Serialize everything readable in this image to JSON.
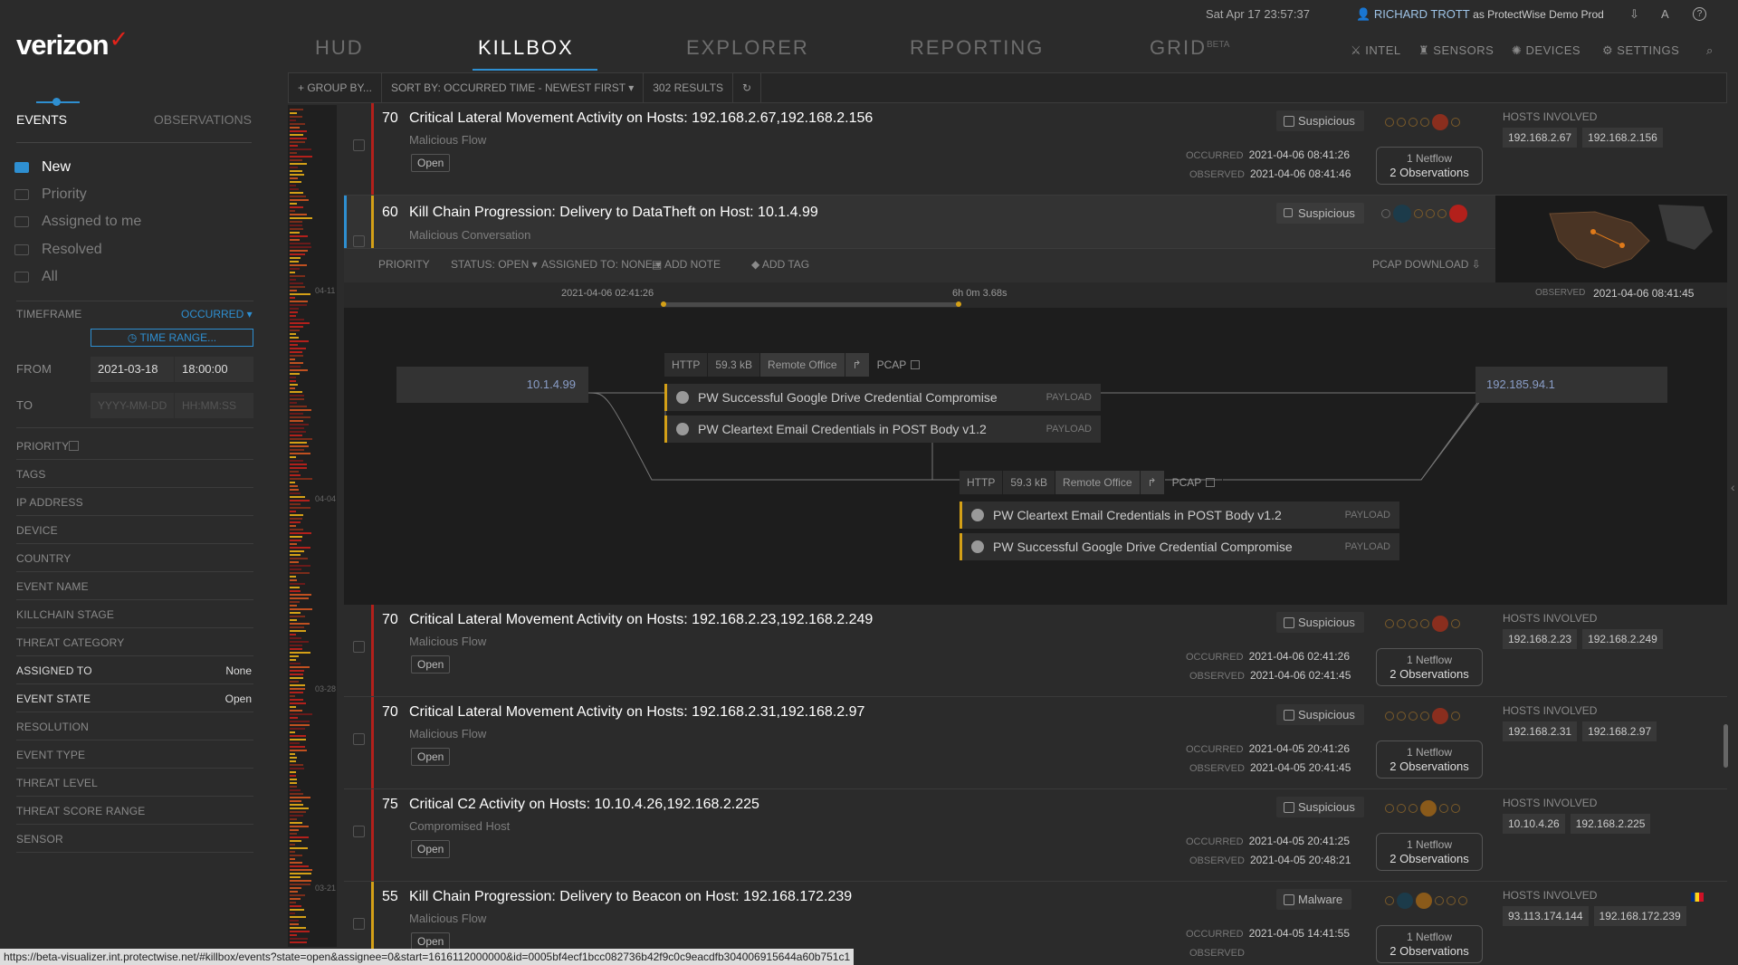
{
  "app": {
    "logo": "verizon",
    "logo_mark": "✓"
  },
  "top": {
    "datetime": "Sat Apr 17 23:57:37",
    "user": "RICHARD TROTT",
    "org": "as ProtectWise Demo Prod",
    "font_size_label": "A"
  },
  "main_tabs": [
    {
      "label": "HUD"
    },
    {
      "label": "KILLBOX"
    },
    {
      "label": "EXPLORER"
    },
    {
      "label": "REPORTING"
    },
    {
      "label": "GRID"
    }
  ],
  "grid_beta": "BETA",
  "right_nav": [
    {
      "label": "INTEL"
    },
    {
      "label": "SENSORS"
    },
    {
      "label": "DEVICES"
    },
    {
      "label": "SETTINGS"
    }
  ],
  "sidebar": {
    "tabs": [
      {
        "label": "EVENTS"
      },
      {
        "label": "OBSERVATIONS"
      }
    ],
    "folders": [
      {
        "label": "New"
      },
      {
        "label": "Priority"
      },
      {
        "label": "Assigned to me"
      },
      {
        "label": "Resolved"
      },
      {
        "label": "All"
      }
    ],
    "timeframe_label": "TIMEFRAME",
    "timeframe_value": "OCCURRED ▾",
    "time_range_button": "TIME RANGE...",
    "from_label": "FROM",
    "from_date": "2021-03-18",
    "from_time": "18:00:00",
    "to_label": "TO",
    "to_date_placeholder": "YYYY-MM-DD",
    "to_time_placeholder": "HH:MM:SS",
    "filters": [
      {
        "label": "PRIORITY",
        "value": ""
      },
      {
        "label": "TAGS",
        "value": ""
      },
      {
        "label": "IP ADDRESS",
        "value": ""
      },
      {
        "label": "DEVICE",
        "value": ""
      },
      {
        "label": "COUNTRY",
        "value": ""
      },
      {
        "label": "EVENT NAME",
        "value": ""
      },
      {
        "label": "KILLCHAIN STAGE",
        "value": ""
      },
      {
        "label": "THREAT CATEGORY",
        "value": ""
      },
      {
        "label": "ASSIGNED TO",
        "value": "None"
      },
      {
        "label": "EVENT STATE",
        "value": "Open"
      },
      {
        "label": "RESOLUTION",
        "value": ""
      },
      {
        "label": "EVENT TYPE",
        "value": ""
      },
      {
        "label": "THREAT LEVEL",
        "value": ""
      },
      {
        "label": "THREAT SCORE RANGE",
        "value": ""
      },
      {
        "label": "SENSOR",
        "value": ""
      }
    ]
  },
  "strip_dates": [
    "04-11",
    "04-04",
    "03-28",
    "03-21"
  ],
  "toolbar": {
    "group_by": "+ GROUP BY...",
    "sort_by": "SORT BY: OCCURRED TIME - NEWEST FIRST ▾",
    "results": "302 RESULTS",
    "refresh": "↻"
  },
  "events": [
    {
      "score": "70",
      "title": "Critical Lateral Movement Activity on Hosts: 192.168.2.67,192.168.2.156",
      "sub": "Malicious Flow",
      "status": "Open",
      "classification": "Suspicious",
      "occurred_label": "OCCURRED",
      "occurred": "2021-04-06 08:41:26",
      "observed_label": "OBSERVED",
      "observed": "2021-04-06 08:41:46",
      "netflow": "1 Netflow",
      "observations": "2 Observations",
      "hosts_label": "HOSTS INVOLVED",
      "hosts": [
        "192.168.2.67",
        "192.168.2.156"
      ]
    },
    {
      "score": "70",
      "title": "Critical Lateral Movement Activity on Hosts: 192.168.2.23,192.168.2.249",
      "sub": "Malicious Flow",
      "status": "Open",
      "classification": "Suspicious",
      "occurred_label": "OCCURRED",
      "occurred": "2021-04-06 02:41:26",
      "observed_label": "OBSERVED",
      "observed": "2021-04-06 02:41:45",
      "netflow": "1 Netflow",
      "observations": "2 Observations",
      "hosts_label": "HOSTS INVOLVED",
      "hosts": [
        "192.168.2.23",
        "192.168.2.249"
      ]
    },
    {
      "score": "70",
      "title": "Critical Lateral Movement Activity on Hosts: 192.168.2.31,192.168.2.97",
      "sub": "Malicious Flow",
      "status": "Open",
      "classification": "Suspicious",
      "occurred_label": "OCCURRED",
      "occurred": "2021-04-05 20:41:26",
      "observed_label": "OBSERVED",
      "observed": "2021-04-05 20:41:45",
      "netflow": "1 Netflow",
      "observations": "2 Observations",
      "hosts_label": "HOSTS INVOLVED",
      "hosts": [
        "192.168.2.31",
        "192.168.2.97"
      ]
    },
    {
      "score": "75",
      "title": "Critical C2 Activity on Hosts: 10.10.4.26,192.168.2.225",
      "sub": "Compromised Host",
      "status": "Open",
      "classification": "Suspicious",
      "occurred_label": "OCCURRED",
      "occurred": "2021-04-05 20:41:25",
      "observed_label": "OBSERVED",
      "observed": "2021-04-05 20:48:21",
      "netflow": "1 Netflow",
      "observations": "2 Observations",
      "hosts_label": "HOSTS INVOLVED",
      "hosts": [
        "10.10.4.26",
        "192.168.2.225"
      ]
    },
    {
      "score": "55",
      "title": "Kill Chain Progression: Delivery to Beacon on Host: 192.168.172.239",
      "sub": "Malicious Flow",
      "status": "Open",
      "classification": "Malware",
      "occurred_label": "OCCURRED",
      "occurred": "2021-04-05 14:41:55",
      "observed_label": "OBSERVED",
      "observed": "",
      "netflow": "1 Netflow",
      "observations": "2 Observations",
      "hosts_label": "HOSTS INVOLVED",
      "hosts": [
        "93.113.174.144",
        "192.168.172.239"
      ]
    }
  ],
  "expanded": {
    "score": "60",
    "title": "Kill Chain Progression: Delivery to DataTheft on Host: 10.1.4.99",
    "sub": "Malicious Conversation",
    "classification": "Suspicious",
    "actions": {
      "priority": "PRIORITY",
      "status": "STATUS: OPEN ▾",
      "assigned": "ASSIGNED TO: NONE ▾",
      "note": "ADD NOTE",
      "tag": "ADD TAG",
      "pcap": "PCAP DOWNLOAD"
    },
    "timeline": {
      "start": "2021-04-06 02:41:26",
      "duration": "6h 0m 3.68s",
      "observed_label": "OBSERVED",
      "observed": "2021-04-06 08:41:45"
    },
    "source": "10.1.4.99",
    "dest": "192.185.94.1",
    "flows": [
      {
        "proto": "HTTP",
        "size": "59.3 kB",
        "site": "Remote Office",
        "pcap": "PCAP",
        "sigs": [
          {
            "name": "PW Successful Google Drive Credential Compromise",
            "tag": "PAYLOAD"
          },
          {
            "name": "PW Cleartext Email Credentials in POST Body v1.2",
            "tag": "PAYLOAD"
          }
        ]
      },
      {
        "proto": "HTTP",
        "size": "59.3 kB",
        "site": "Remote Office",
        "pcap": "PCAP",
        "sigs": [
          {
            "name": "PW Cleartext Email Credentials in POST Body v1.2",
            "tag": "PAYLOAD"
          },
          {
            "name": "PW Successful Google Drive Credential Compromise",
            "tag": "PAYLOAD"
          }
        ]
      }
    ]
  },
  "statusbar": "https://beta-visualizer.int.protectwise.net/#killbox/events?state=open&assignee=0&start=1616112000000&id=0005bf4ecf1bcc082736b42f9c0c9eacdfb304006915644a60b751c1",
  "colors": {
    "accent": "#2e8fd1",
    "critical": "#b3201b",
    "warning": "#d4a017"
  }
}
